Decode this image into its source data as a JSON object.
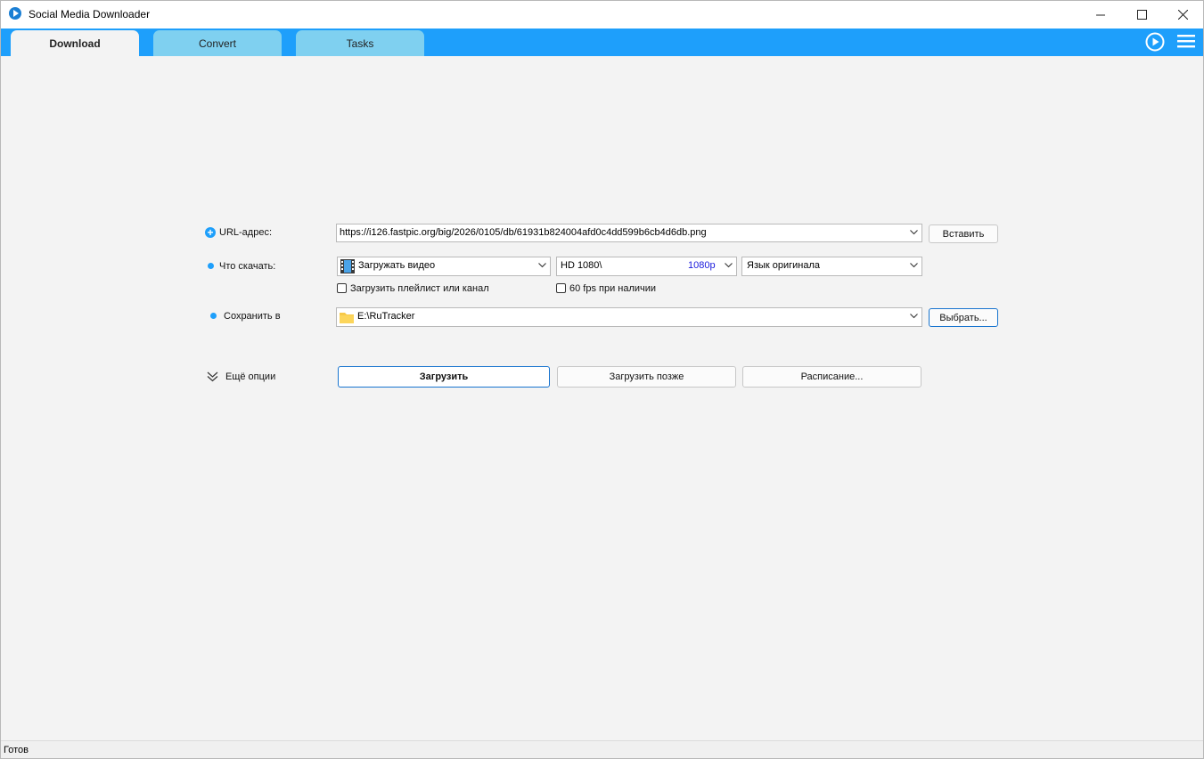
{
  "window": {
    "title": "Social Media Downloader"
  },
  "tabs": [
    {
      "label": "Download",
      "active": true
    },
    {
      "label": "Convert",
      "active": false
    },
    {
      "label": "Tasks",
      "active": false
    }
  ],
  "form": {
    "url_label": "URL-адрес:",
    "url_value": "https://i126.fastpic.org/big/2026/0105/db/61931b824004afd0c4dd599b6cb4d6db.png",
    "paste_button": "Вставить",
    "what_label": "Что скачать:",
    "download_type": "Загружать видео",
    "quality_name": "HD 1080\\",
    "quality_value": "1080p",
    "audio_language": "Язык оригинала",
    "playlist_checkbox": "Загрузить плейлист или канал",
    "fps_checkbox": "60 fps при наличии",
    "save_label": "Сохранить в",
    "save_path": "E:\\RuTracker",
    "browse_button": "Выбрать...",
    "more_options": "Ещё опции",
    "download_button": "Загрузить",
    "download_later_button": "Загрузить позже",
    "schedule_button": "Расписание..."
  },
  "status": {
    "text": "Готов"
  },
  "colors": {
    "accent": "#1e9ffb",
    "tab_inactive": "#7fd0f0",
    "quality_value": "#1a1adc"
  },
  "icons": [
    "app-logo-icon",
    "minimize-icon",
    "maximize-icon",
    "close-icon",
    "play-circle-icon",
    "hamburger-menu-icon",
    "plus-circle-icon",
    "film-icon",
    "folder-icon",
    "double-chevron-down-icon",
    "chevron-down-icon"
  ]
}
